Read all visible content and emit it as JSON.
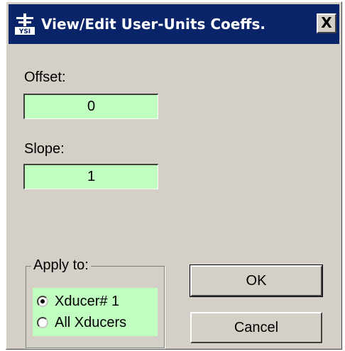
{
  "window": {
    "title": "View/Edit User-Units Coeffs.",
    "close_label": "X",
    "icon_text": "YSI"
  },
  "offset": {
    "label": "Offset:",
    "value": "0"
  },
  "slope": {
    "label": "Slope:",
    "value": "1"
  },
  "apply_to": {
    "legend": "Apply to:",
    "options": [
      {
        "label": "Xducer# 1",
        "selected": true
      },
      {
        "label": "All Xducers",
        "selected": false
      }
    ]
  },
  "buttons": {
    "ok_label": "OK",
    "cancel_label": "Cancel"
  },
  "colors": {
    "titlebar": "#0a246a",
    "dialog_face": "#d4d0c8",
    "field_background": "#c0ffc0"
  }
}
